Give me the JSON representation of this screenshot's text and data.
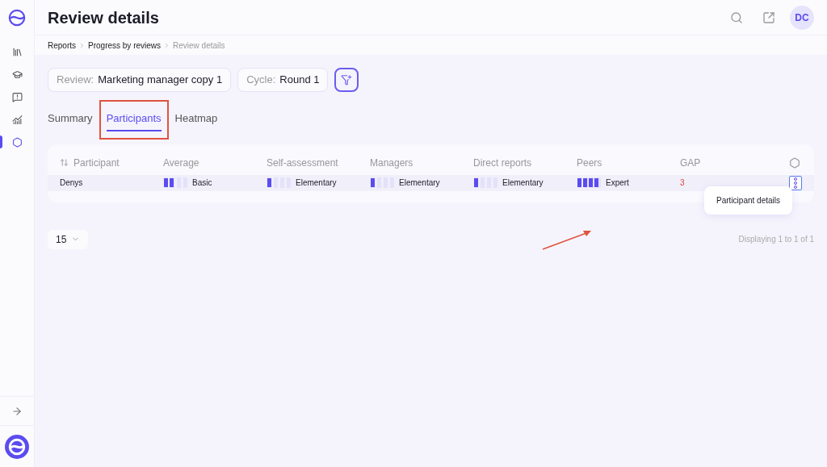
{
  "sidebar": {
    "items": [
      {
        "kind": "library",
        "selected": false
      },
      {
        "kind": "education",
        "selected": false
      },
      {
        "kind": "feedback",
        "selected": false
      },
      {
        "kind": "analytics",
        "selected": false
      },
      {
        "kind": "settings",
        "selected": true
      }
    ]
  },
  "header": {
    "title": "Review details",
    "avatar": "DC"
  },
  "breadcrumbs": [
    {
      "label": "Reports",
      "current": false
    },
    {
      "label": "Progress by reviews",
      "current": false
    },
    {
      "label": "Review details",
      "current": true
    }
  ],
  "filters": [
    {
      "label": "Review:",
      "value": "Marketing manager copy 1"
    },
    {
      "label": "Cycle:",
      "value": "Round 1"
    }
  ],
  "tabs": [
    {
      "label": "Summary",
      "selected": false
    },
    {
      "label": "Participants",
      "selected": true
    },
    {
      "label": "Heatmap",
      "selected": false
    }
  ],
  "table": {
    "columns": [
      "Participant",
      "Average",
      "Self-assessment",
      "Managers",
      "Direct reports",
      "Peers",
      "GAP"
    ],
    "rows": [
      {
        "participant": "Denys",
        "ratings": [
          {
            "label": "Basic",
            "level": 0.5
          },
          {
            "label": "Elementary",
            "level": 0.25
          },
          {
            "label": "Elementary",
            "level": 0.25
          },
          {
            "label": "Elementary",
            "level": 0.25
          },
          {
            "label": "Expert",
            "level": 1
          }
        ],
        "gap": "3"
      }
    ]
  },
  "menu": {
    "items": [
      "Participant details"
    ]
  },
  "pagination": {
    "page_size": "15",
    "summary": "Displaying 1 to 1 of 1"
  }
}
